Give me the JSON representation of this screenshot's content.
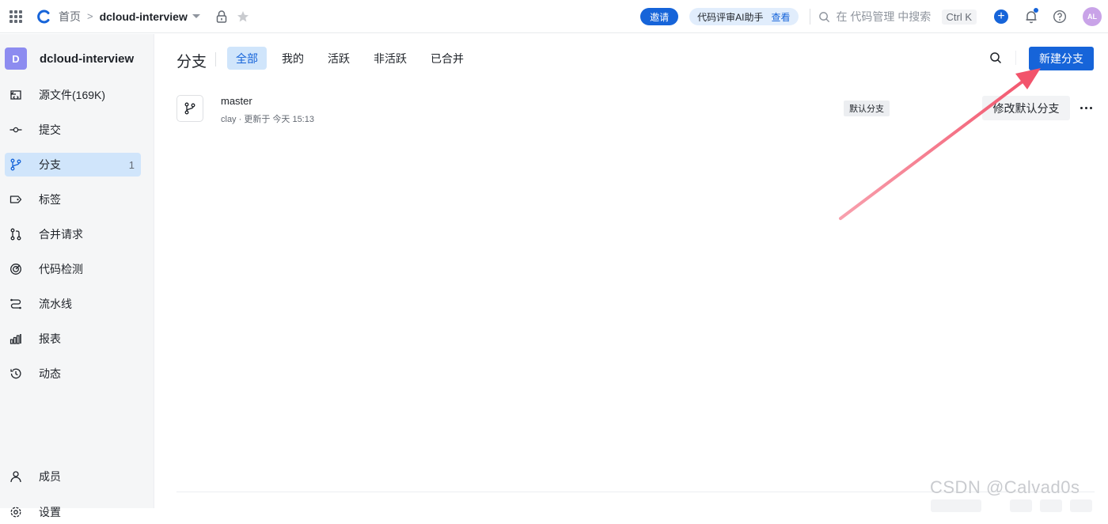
{
  "topbar": {
    "breadcrumb_home": "首页",
    "breadcrumb_sep": ">",
    "repo_name": "dcloud-interview",
    "invite_label": "邀请",
    "ai_pill_text": "代码评审AI助手",
    "ai_pill_link": "查看",
    "search_placeholder": "在 代码管理 中搜索",
    "shortcut": "Ctrl K",
    "avatar_initials": "AL"
  },
  "sidebar": {
    "repo_badge": "D",
    "repo_name": "dcloud-interview",
    "items": [
      {
        "label": "源文件(169K)",
        "icon": "file-code-icon",
        "count": ""
      },
      {
        "label": "提交",
        "icon": "commit-icon",
        "count": ""
      },
      {
        "label": "分支",
        "icon": "branch-icon",
        "count": "1",
        "active": true
      },
      {
        "label": "标签",
        "icon": "tag-icon",
        "count": ""
      },
      {
        "label": "合并请求",
        "icon": "merge-request-icon",
        "count": ""
      },
      {
        "label": "代码检测",
        "icon": "code-scan-icon",
        "count": ""
      },
      {
        "label": "流水线",
        "icon": "pipeline-icon",
        "count": ""
      },
      {
        "label": "报表",
        "icon": "report-icon",
        "count": ""
      },
      {
        "label": "动态",
        "icon": "history-icon",
        "count": ""
      }
    ],
    "members_label": "成员",
    "settings_label": "设置"
  },
  "main": {
    "title": "分支",
    "tabs": [
      "全部",
      "我的",
      "活跃",
      "非活跃",
      "已合并"
    ],
    "active_tab": "全部",
    "new_branch_label": "新建分支",
    "branches": [
      {
        "name": "master",
        "meta": "clay · 更新于 今天 15:13",
        "tag": "默认分支",
        "action_label": "修改默认分支"
      }
    ]
  },
  "colors": {
    "accent": "#1664d9",
    "active_bg": "#d0e5fb",
    "annotation_arrow": "#f2536b"
  },
  "watermark": "CSDN @Calvad0s"
}
